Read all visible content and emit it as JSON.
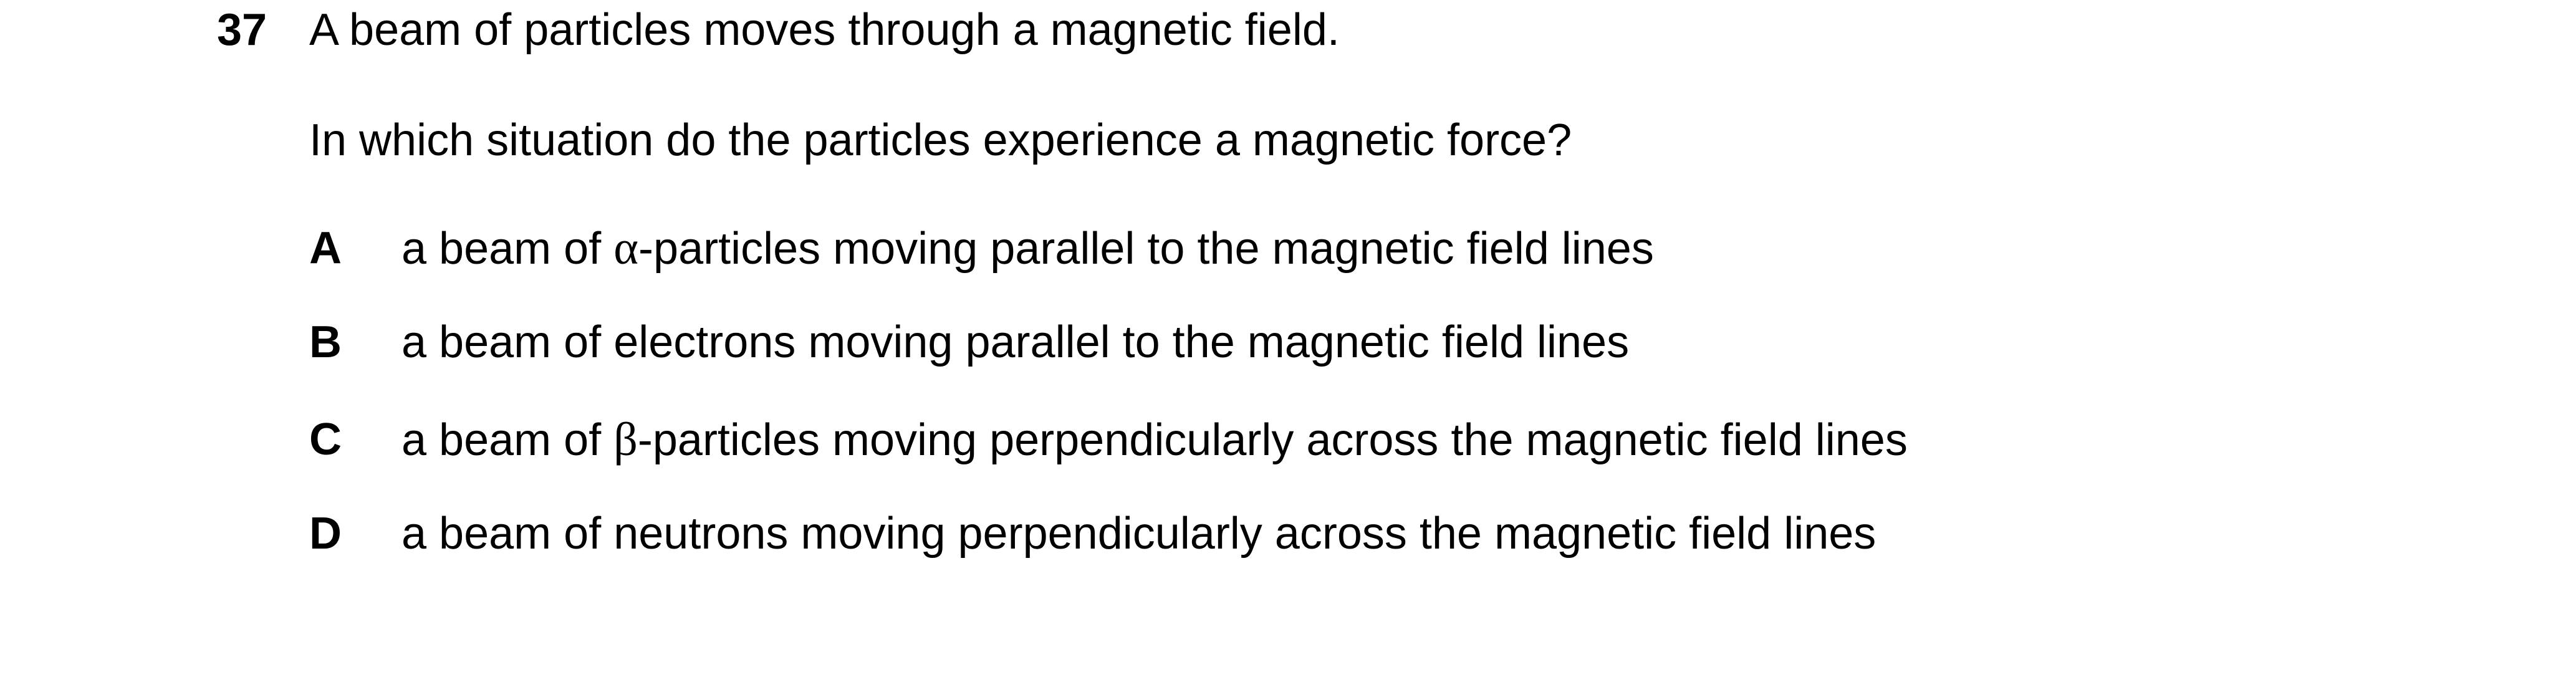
{
  "question": {
    "number": "37",
    "stem_line_1": "A beam of particles moves through a magnetic field.",
    "stem_line_2": "In which situation do the particles experience a magnetic force?"
  },
  "options": [
    {
      "letter": "A",
      "text_before": "a beam of ",
      "symbol": "α",
      "text_after": "-particles moving parallel to the magnetic field lines"
    },
    {
      "letter": "B",
      "text_before": "a beam of electrons moving parallel to the magnetic field lines",
      "symbol": "",
      "text_after": ""
    },
    {
      "letter": "C",
      "text_before": "a beam of ",
      "symbol": "β",
      "text_after": "-particles moving perpendicularly across the magnetic field lines"
    },
    {
      "letter": "D",
      "text_before": "a beam of neutrons moving perpendicularly across the magnetic field lines",
      "symbol": "",
      "text_after": ""
    }
  ]
}
